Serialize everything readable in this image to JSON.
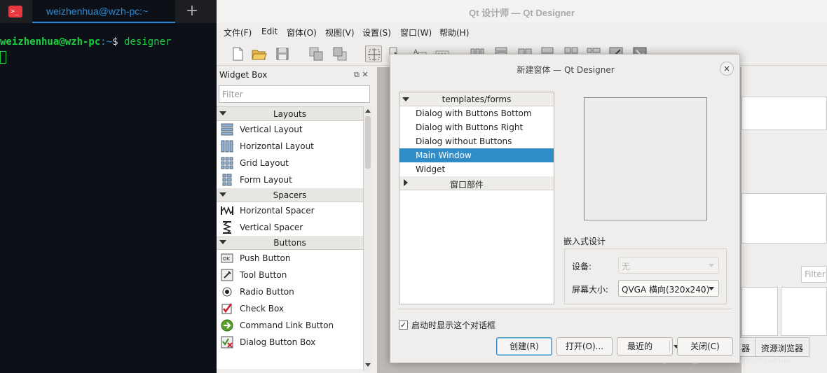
{
  "terminal": {
    "tab_label": "weizhenhua@wzh-pc:~",
    "add_tab": "+",
    "prompt_user": "weizhenhua@wzh-pc",
    "prompt_path": ":~",
    "prompt_symbol": "$",
    "command": "designer"
  },
  "designer": {
    "window_title": "Qt 设计师 — Qt Designer",
    "menu": [
      "文件(F)",
      "Edit",
      "窗体(O)",
      "视图(V)",
      "设置(S)",
      "窗口(W)",
      "帮助(H)"
    ],
    "toolbar_icons": [
      "new-icon",
      "open-icon",
      "save-icon",
      "bring-front-icon",
      "send-back-icon",
      "edit-widgets-icon",
      "edit-signals-icon",
      "edit-buddies-icon",
      "edit-tab-order-icon",
      "layout-horizontal-icon",
      "layout-vertical-icon",
      "layout-splitter-h-icon",
      "layout-splitter-v-icon",
      "layout-grid-icon",
      "layout-form-icon",
      "break-layout-icon",
      "adjust-size-icon"
    ]
  },
  "widget_box": {
    "title": "Widget Box",
    "filter_placeholder": "Filter",
    "categories": [
      {
        "label": "Layouts",
        "items": [
          "Vertical Layout",
          "Horizontal Layout",
          "Grid Layout",
          "Form Layout"
        ]
      },
      {
        "label": "Spacers",
        "items": [
          "Horizontal Spacer",
          "Vertical Spacer"
        ]
      },
      {
        "label": "Buttons",
        "items": [
          "Push Button",
          "Tool Button",
          "Radio Button",
          "Check Box",
          "Command Link Button",
          "Dialog Button Box"
        ]
      }
    ]
  },
  "right_panel": {
    "filter_placeholder": "Filter",
    "tabs": [
      "器",
      "资源浏览器"
    ]
  },
  "dialog": {
    "title": "新建窗体 — Qt Designer",
    "close_icon": "×",
    "tree_header": "templates/forms",
    "templates": [
      "Dialog with Buttons Bottom",
      "Dialog with Buttons Right",
      "Dialog without Buttons",
      "Main Window",
      "Widget"
    ],
    "selected_template": "Main Window",
    "second_header": "窗口部件",
    "embedded_design": "嵌入式设计",
    "device_label": "设备:",
    "device_value": "无",
    "screen_size_label": "屏幕大小:",
    "screen_size_value": "QVGA 横向(320x240)",
    "show_on_startup": "启动时显示这个对话框",
    "show_on_startup_checked": true,
    "buttons": {
      "create": "创建(R)",
      "open": "打开(O)...",
      "recent": "最近的",
      "close": "关闭(C)"
    }
  },
  "watermark": "https://blog.csdn.net/sishuihuahua",
  "colors": {
    "terminal_bg": "#0d1117",
    "terminal_green": "#19d140",
    "terminal_blue": "#2c8cd9",
    "selection": "#308cc6"
  }
}
